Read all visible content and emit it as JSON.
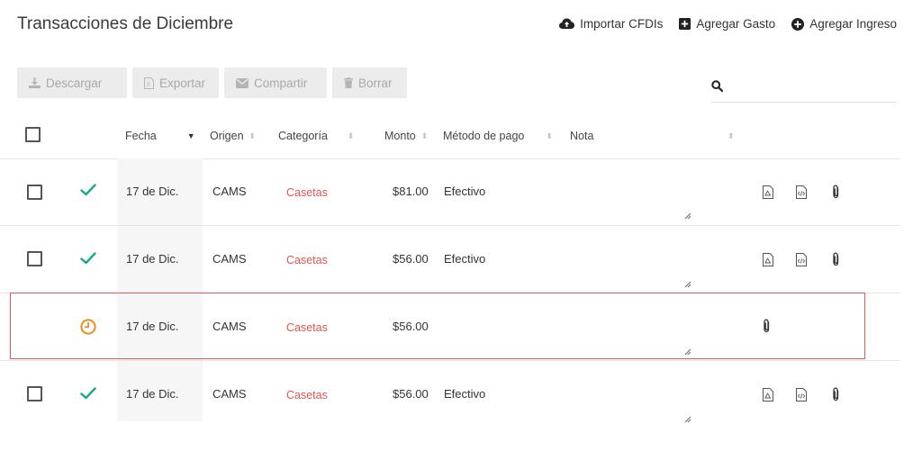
{
  "header": {
    "title": "Transacciones de Diciembre",
    "actions": [
      {
        "label": "Importar CFDIs",
        "icon": "cloud-upload-icon"
      },
      {
        "label": "Agregar Gasto",
        "icon": "plus-square-icon"
      },
      {
        "label": "Agregar Ingreso",
        "icon": "plus-circle-icon"
      }
    ]
  },
  "toolbar": {
    "buttons": [
      {
        "label": "Descargar",
        "icon": "download-icon"
      },
      {
        "label": "Exportar",
        "icon": "excel-icon"
      },
      {
        "label": "Compartir",
        "icon": "envelope-icon"
      },
      {
        "label": "Borrar",
        "icon": "trash-icon"
      }
    ],
    "search_placeholder": ""
  },
  "table": {
    "columns": {
      "fecha": "Fecha",
      "origen": "Origen",
      "categoria": "Categoría",
      "monto": "Monto",
      "metodo": "Método de pago",
      "nota": "Nota"
    },
    "rows": [
      {
        "status": "check-icon",
        "date": "17 de Dic.",
        "origin": "CAMS",
        "category": "Casetas",
        "amount": "$81.00",
        "method": "Efectivo",
        "note": ""
      },
      {
        "status": "check-icon",
        "date": "17 de Dic.",
        "origin": "CAMS",
        "category": "Casetas",
        "amount": "$56.00",
        "method": "Efectivo",
        "note": ""
      },
      {
        "status": "clock-icon",
        "date": "17 de Dic.",
        "origin": "CAMS",
        "category": "Casetas",
        "amount": "$56.00",
        "method": "",
        "note": ""
      },
      {
        "status": "check-icon",
        "date": "17 de Dic.",
        "origin": "CAMS",
        "category": "Casetas",
        "amount": "$56.00",
        "method": "Efectivo",
        "note": ""
      }
    ]
  },
  "colors": {
    "check": "#1aa88a",
    "clock": "#f08c1e",
    "category": "#e0564f",
    "highlight_border": "#e05a5a"
  }
}
